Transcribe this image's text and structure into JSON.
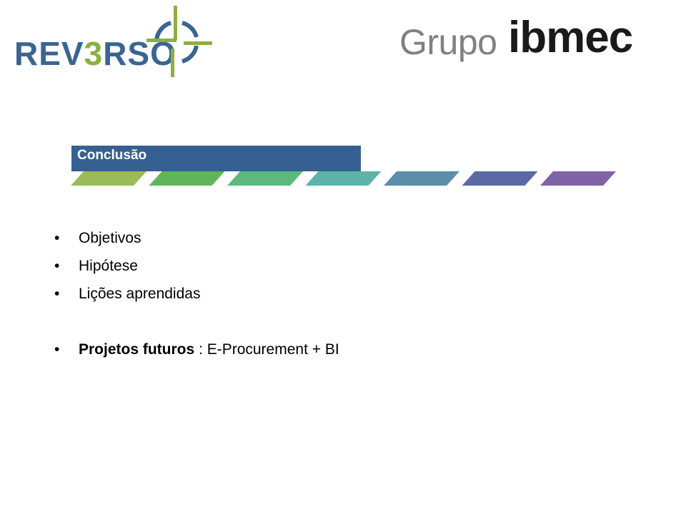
{
  "header": {
    "left_logo": {
      "text_pre": "REV",
      "text_three": "3",
      "text_post": "RSO",
      "brand_blue": "#3a6592",
      "brand_green": "#8cb040"
    },
    "right_logo": {
      "text_grupo": "Grupo",
      "text_ibmec": "ibmec"
    }
  },
  "section": {
    "title": "Conclusão",
    "bar_color": "#366092",
    "step_colors": [
      "#9bbb59",
      "#5fb65a",
      "#5cb87d",
      "#5cb3a8",
      "#5a8eaa",
      "#5b6aa6",
      "#7f63a5"
    ]
  },
  "bullets": [
    {
      "text": "Objetivos"
    },
    {
      "text": "Hipótese"
    },
    {
      "text": "Lições aprendidas"
    },
    {
      "bold": "Projetos futuros",
      "text": " : E-Procurement + BI"
    }
  ],
  "bullet_glyph": "•"
}
